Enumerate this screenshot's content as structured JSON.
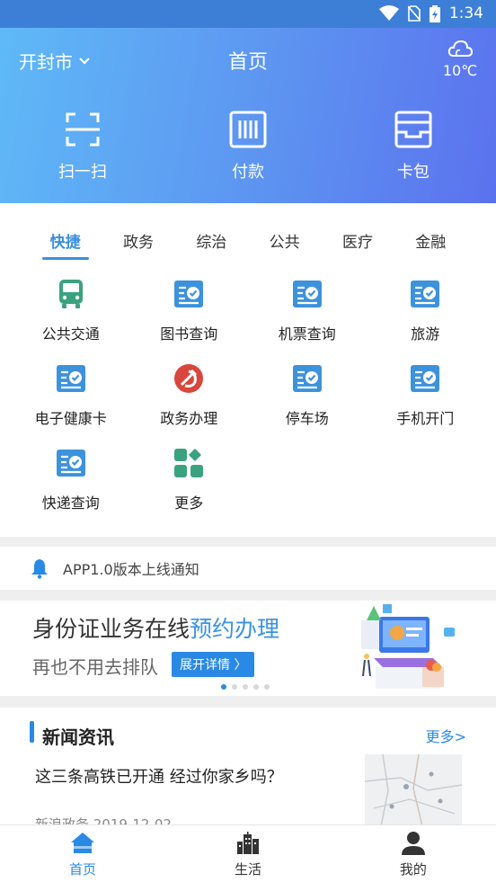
{
  "status_bar": {
    "time": "1:34"
  },
  "header": {
    "city": "开封市",
    "title": "首页",
    "temperature": "10℃",
    "actions": [
      {
        "label": "扫一扫",
        "icon": "scan-icon"
      },
      {
        "label": "付款",
        "icon": "barcode-pay-icon"
      },
      {
        "label": "卡包",
        "icon": "card-wallet-icon"
      }
    ]
  },
  "tabs": [
    "快捷",
    "政务",
    "综治",
    "公共",
    "医疗",
    "金融"
  ],
  "services": [
    {
      "label": "公共交通",
      "icon": "bus-icon"
    },
    {
      "label": "图书查询",
      "icon": "document-check-icon"
    },
    {
      "label": "机票查询",
      "icon": "document-check-icon"
    },
    {
      "label": "旅游",
      "icon": "document-check-icon"
    },
    {
      "label": "电子健康卡",
      "icon": "document-check-icon"
    },
    {
      "label": "政务办理",
      "icon": "party-emblem-icon"
    },
    {
      "label": "停车场",
      "icon": "document-check-icon"
    },
    {
      "label": "手机开门",
      "icon": "document-check-icon"
    },
    {
      "label": "快递查询",
      "icon": "document-check-icon"
    },
    {
      "label": "更多",
      "icon": "more-grid-icon"
    }
  ],
  "notice": {
    "text": "APP1.0版本上线通知"
  },
  "banner": {
    "title_plain": "身份证业务在线",
    "title_highlight": "预约办理",
    "subtitle": "再也不用去排队",
    "button": "展开详情 〉"
  },
  "news": {
    "section_title": "新闻资讯",
    "more": "更多>",
    "headline": "这三条高铁已开通 经过你家乡吗？",
    "meta": "新浪政务 2019-12-02"
  },
  "tabbar": [
    {
      "label": "首页",
      "icon": "home-icon"
    },
    {
      "label": "生活",
      "icon": "city-buildings-icon"
    },
    {
      "label": "我的",
      "icon": "user-icon"
    }
  ],
  "colors": {
    "accent": "#2a89e4",
    "service_icon": "#3d92dc",
    "bus_icon": "#3ba27f",
    "emblem": "#d8463c"
  }
}
